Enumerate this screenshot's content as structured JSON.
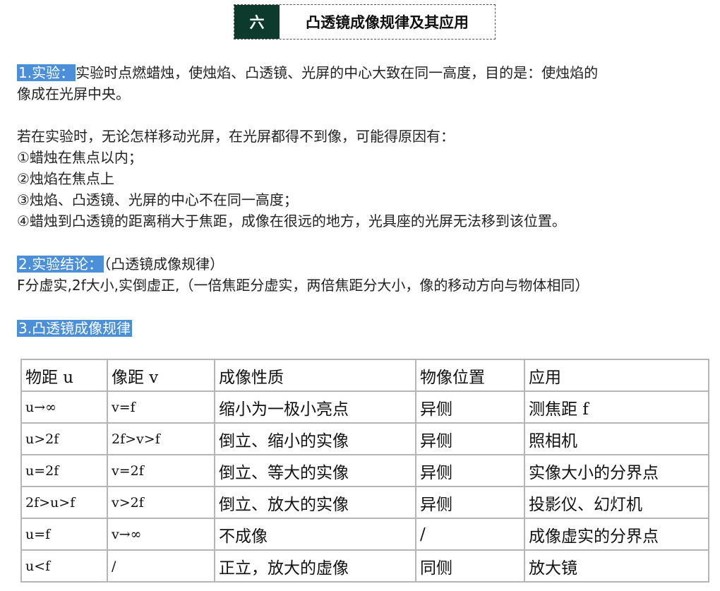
{
  "header": {
    "number": "六",
    "title": "凸透镜成像规律及其应用"
  },
  "section1": {
    "label": "1.实验：",
    "text_a": "实验时点燃蜡烛，使烛焰、凸透镜、光屏的中心大致在同一高度，目的是：使烛焰的",
    "text_b": "像成在光屏中央。",
    "reason_intro": "若在实验时，无论怎样移动光屏，在光屏都得不到像，可能得原因有：",
    "reasons": [
      "①蜡烛在焦点以内；",
      "②烛焰在焦点上",
      "③烛焰、凸透镜、光屏的中心不在同一高度；",
      "④蜡烛到凸透镜的距离稍大于焦距，成像在很远的地方，光具座的光屏无法移到该位置。"
    ]
  },
  "section2": {
    "label": "2.实验结论：",
    "note": "（凸透镜成像规律）",
    "text": "F分虚实,2f大小,实倒虚正,（一倍焦距分虚实，两倍焦距分大小，像的移动方向与物体相同）"
  },
  "section3": {
    "label": "3.凸透镜成像规律"
  },
  "table": {
    "headers": [
      "物距 u",
      "像距 v",
      "成像性质",
      "物像位置",
      "应用"
    ],
    "rows": [
      [
        "u→∞",
        "v=f",
        "缩小为一极小亮点",
        "异侧",
        "测焦距 f"
      ],
      [
        "u>2f",
        "2f>v>f",
        "倒立、缩小的实像",
        "异侧",
        "照相机"
      ],
      [
        "u=2f",
        "v=2f",
        "倒立、等大的实像",
        "异侧",
        "实像大小的分界点"
      ],
      [
        "2f>u>f",
        "v>2f",
        "倒立、放大的实像",
        "异侧",
        "投影仪、幻灯机"
      ],
      [
        "u=f",
        "v→∞",
        "不成像",
        "/",
        "成像虚实的分界点"
      ],
      [
        "u<f",
        "/",
        "正立，放大的虚像",
        "同侧",
        "放大镜"
      ]
    ]
  },
  "colors": {
    "header_bg": "#0c3b2e",
    "highlight": "#4a8fd8",
    "table_border": "#b5b5b5"
  }
}
